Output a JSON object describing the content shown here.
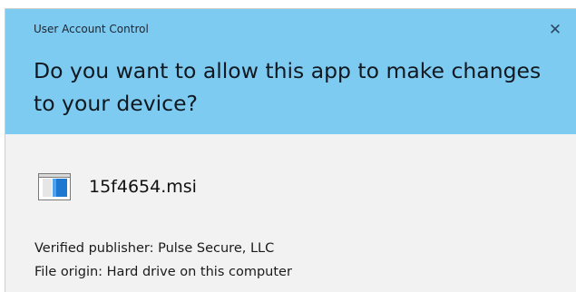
{
  "dialog": {
    "caption": "User Account Control",
    "close_symbol": "✕",
    "question": "Do you want to allow this app to make changes to your device?",
    "colors": {
      "header_background": "#7ecbf1",
      "body_background": "#f2f2f2"
    }
  },
  "app": {
    "icon": "msi-installer-icon",
    "file_name": "15f4654.msi",
    "publisher_line": "Verified publisher: Pulse Secure, LLC",
    "origin_line": "File origin: Hard drive on this computer"
  }
}
